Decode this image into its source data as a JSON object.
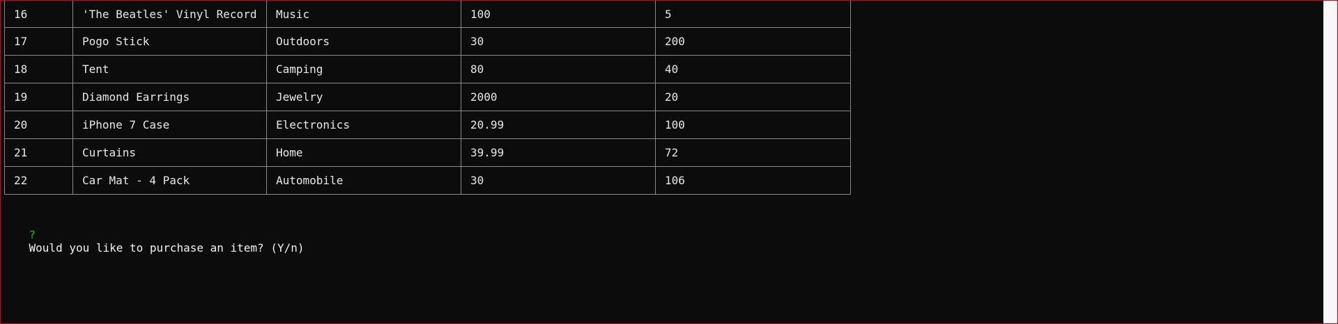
{
  "window": {
    "border_color": "#d0021b",
    "background": "#0c0c0c"
  },
  "products": {
    "rows": [
      {
        "id": "16",
        "name": "'The Beatles' Vinyl Record",
        "department": "Music",
        "price": "100",
        "quantity": "5"
      },
      {
        "id": "17",
        "name": "Pogo Stick",
        "department": "Outdoors",
        "price": "30",
        "quantity": "200"
      },
      {
        "id": "18",
        "name": "Tent",
        "department": "Camping",
        "price": "80",
        "quantity": "40"
      },
      {
        "id": "19",
        "name": "Diamond Earrings",
        "department": "Jewelry",
        "price": "2000",
        "quantity": "20"
      },
      {
        "id": "20",
        "name": "iPhone 7 Case",
        "department": "Electronics",
        "price": "20.99",
        "quantity": "100"
      },
      {
        "id": "21",
        "name": "Curtains",
        "department": "Home",
        "price": "39.99",
        "quantity": "72"
      },
      {
        "id": "22",
        "name": "Car Mat - 4 Pack",
        "department": "Automobile",
        "price": "30",
        "quantity": "106"
      }
    ]
  },
  "prompt": {
    "marker": "?",
    "marker_color": "#16c60c",
    "question": "Would you like to purchase an item? (Y/n)"
  }
}
